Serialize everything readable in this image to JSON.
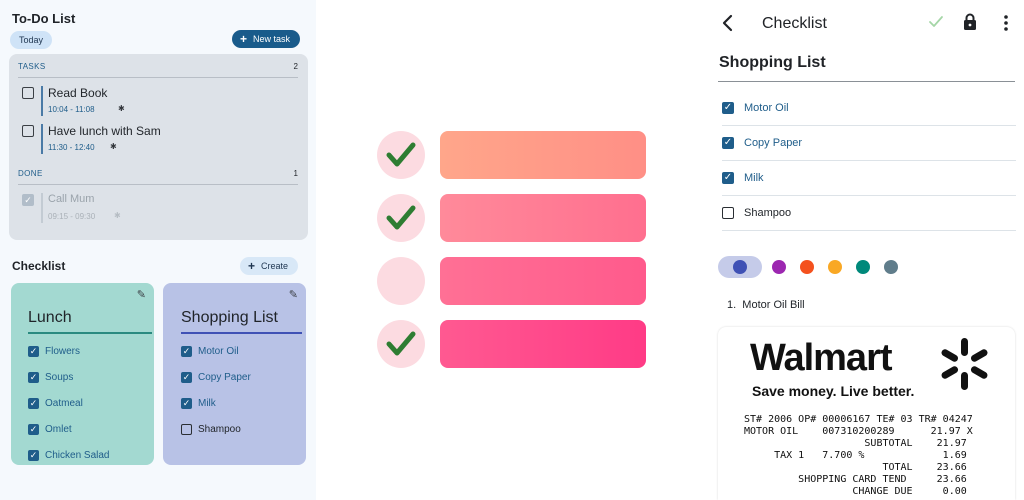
{
  "todo": {
    "title": "To-Do List",
    "filter_chip": "Today",
    "new_task_label": "New task",
    "tasks_label": "TASKS",
    "tasks_count": "2",
    "tasks": [
      {
        "title": "Read Book",
        "time": "10:04 - 11:08"
      },
      {
        "title": "Have lunch with Sam",
        "time": "11:30 - 12:40"
      }
    ],
    "done_label": "DONE",
    "done_count": "1",
    "done": [
      {
        "title": "Call Mum",
        "time": "09:15 - 09:30"
      }
    ]
  },
  "checklist": {
    "title": "Checklist",
    "create_label": "Create",
    "cards": [
      {
        "title": "Lunch",
        "color": "#a3d9d1",
        "underline": "#2a8a80",
        "items": [
          {
            "label": "Flowers",
            "checked": true
          },
          {
            "label": "Soups",
            "checked": true
          },
          {
            "label": "Oatmeal",
            "checked": true
          },
          {
            "label": "Omlet",
            "checked": true
          },
          {
            "label": "Chicken Salad",
            "checked": true
          }
        ]
      },
      {
        "title": "Shopping List",
        "color": "#b8c2e6",
        "underline": "#3f51b5",
        "items": [
          {
            "label": "Motor Oil",
            "checked": true
          },
          {
            "label": "Copy Paper",
            "checked": true
          },
          {
            "label": "Milk",
            "checked": true
          },
          {
            "label": "Shampoo",
            "checked": false
          }
        ]
      }
    ]
  },
  "illustration": {
    "rows": [
      {
        "checked": true,
        "color_from": "#ffa68a",
        "color_to": "#ff8f86"
      },
      {
        "checked": true,
        "color_from": "#ff8a9a",
        "color_to": "#ff6f8f"
      },
      {
        "checked": false,
        "color_from": "#ff7095",
        "color_to": "#ff5a8c"
      },
      {
        "checked": true,
        "color_from": "#ff5991",
        "color_to": "#ff3b86"
      }
    ],
    "check_color": "#2e7d32"
  },
  "detail": {
    "header_title": "Checklist",
    "icons": [
      "back-arrow-icon",
      "check-icon",
      "lock-icon",
      "more-vert-icon"
    ],
    "list_title": "Shopping List",
    "items": [
      {
        "label": "Motor Oil",
        "checked": true
      },
      {
        "label": "Copy Paper",
        "checked": true
      },
      {
        "label": "Milk",
        "checked": true
      },
      {
        "label": "Shampoo",
        "checked": false
      }
    ],
    "color_options": [
      "#3f51b5",
      "#9c27b0",
      "#f4511e",
      "#f9a825",
      "#00897b",
      "#607d8b"
    ],
    "selected_color": "#3f51b5",
    "attachment_label": "1.  Motor Oil Bill",
    "receipt": {
      "brand": "Walmart",
      "tagline": "Save money. Live better.",
      "lines": [
        "ST# 2006 OP# 00006167 TE# 03 TR# 04247",
        "MOTOR OIL    007310200289      21.97 X",
        "                    SUBTOTAL    21.97",
        "     TAX 1   7.700 %             1.69",
        "                       TOTAL    23.66",
        "         SHOPPING CARD TEND     23.66",
        "                  CHANGE DUE     0.00"
      ]
    }
  }
}
